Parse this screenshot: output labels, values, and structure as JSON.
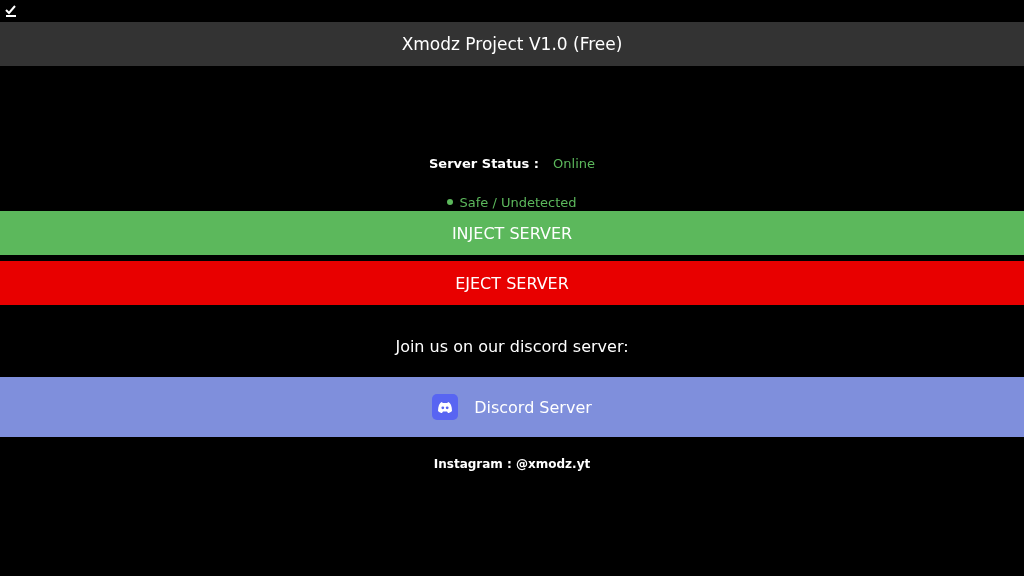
{
  "window": {
    "title": "Xmodz Project V1.0 (Free)"
  },
  "status": {
    "label": "Server Status :",
    "value": "Online",
    "note": "Safe / Undetected"
  },
  "buttons": [
    {
      "label": "INJECT SERVER",
      "kind": "inject"
    },
    {
      "label": "EJECT SERVER",
      "kind": "eject"
    }
  ],
  "discord": {
    "prompt": "Join us on our discord server:",
    "button": "Discord Server"
  },
  "footer": "Instagram : @xmodz.yt"
}
